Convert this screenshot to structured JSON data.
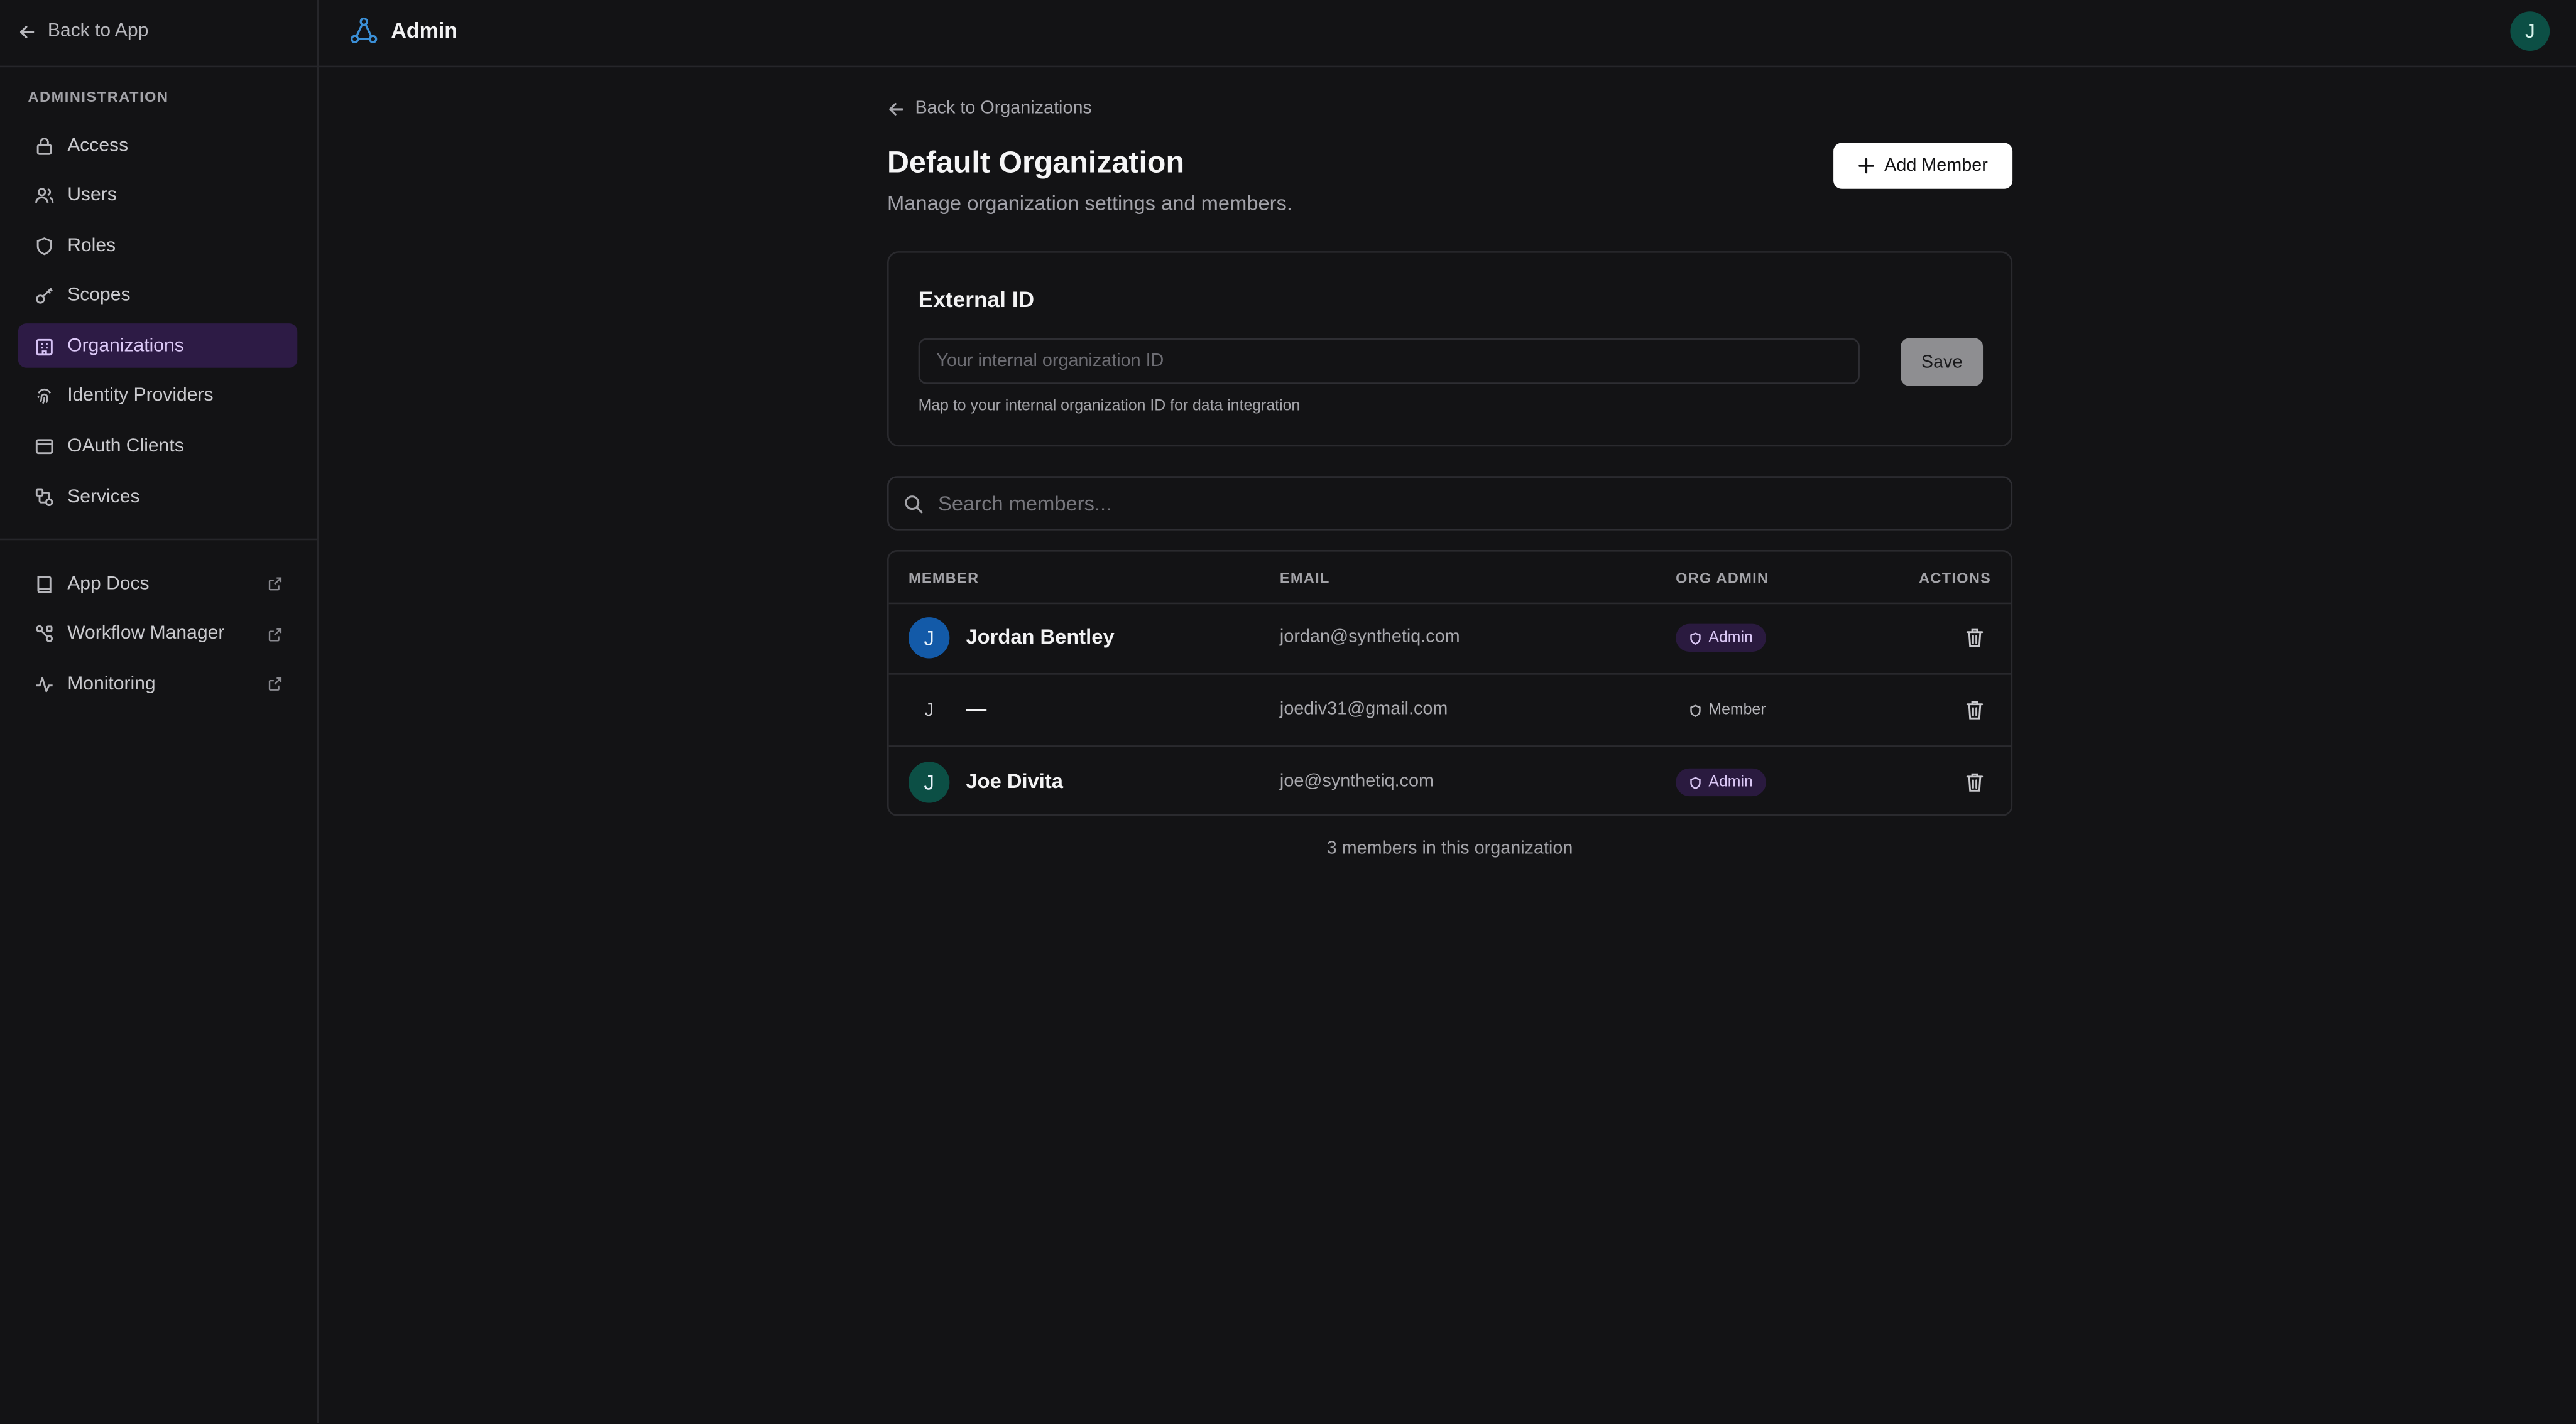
{
  "sidebar": {
    "back_label": "Back to App",
    "section_label": "ADMINISTRATION",
    "items": [
      {
        "label": "Access",
        "icon": "lock-icon"
      },
      {
        "label": "Users",
        "icon": "users-icon"
      },
      {
        "label": "Roles",
        "icon": "shield-icon"
      },
      {
        "label": "Scopes",
        "icon": "key-icon"
      },
      {
        "label": "Organizations",
        "icon": "building-icon",
        "active": true
      },
      {
        "label": "Identity Providers",
        "icon": "fingerprint-icon"
      },
      {
        "label": "OAuth Clients",
        "icon": "window-icon"
      },
      {
        "label": "Services",
        "icon": "services-icon"
      }
    ],
    "external_items": [
      {
        "label": "App Docs",
        "icon": "book-icon"
      },
      {
        "label": "Workflow Manager",
        "icon": "workflow-icon"
      },
      {
        "label": "Monitoring",
        "icon": "activity-icon"
      }
    ]
  },
  "header": {
    "title": "Admin",
    "user_initial": "J"
  },
  "page": {
    "back_label": "Back to Organizations",
    "title": "Default Organization",
    "subtitle": "Manage organization settings and members.",
    "add_member_label": "Add Member"
  },
  "external_id": {
    "title": "External ID",
    "placeholder": "Your internal organization ID",
    "value": "",
    "save_label": "Save",
    "hint": "Map to your internal organization ID for data integration"
  },
  "search": {
    "placeholder": "Search members..."
  },
  "table": {
    "headers": {
      "member": "MEMBER",
      "email": "EMAIL",
      "org_admin": "ORG ADMIN",
      "actions": "ACTIONS"
    },
    "rows": [
      {
        "initial": "J",
        "name": "Jordan Bentley",
        "email": "jordan@synthetiq.com",
        "role": "Admin",
        "avatar_color": "#135aa8"
      },
      {
        "initial": "J",
        "name": "—",
        "email": "joediv31@gmail.com",
        "role": "Member",
        "avatar_color": ""
      },
      {
        "initial": "J",
        "name": "Joe Divita",
        "email": "joe@synthetiq.com",
        "role": "Admin",
        "avatar_color": "#0c4f45"
      }
    ]
  },
  "footer": {
    "count_text": "3 members in this organization"
  },
  "colors": {
    "background": "#131315",
    "active_nav": "#2d1b45",
    "admin_badge": "#2a1a3f",
    "accent_icon": "#3b8fd6"
  }
}
